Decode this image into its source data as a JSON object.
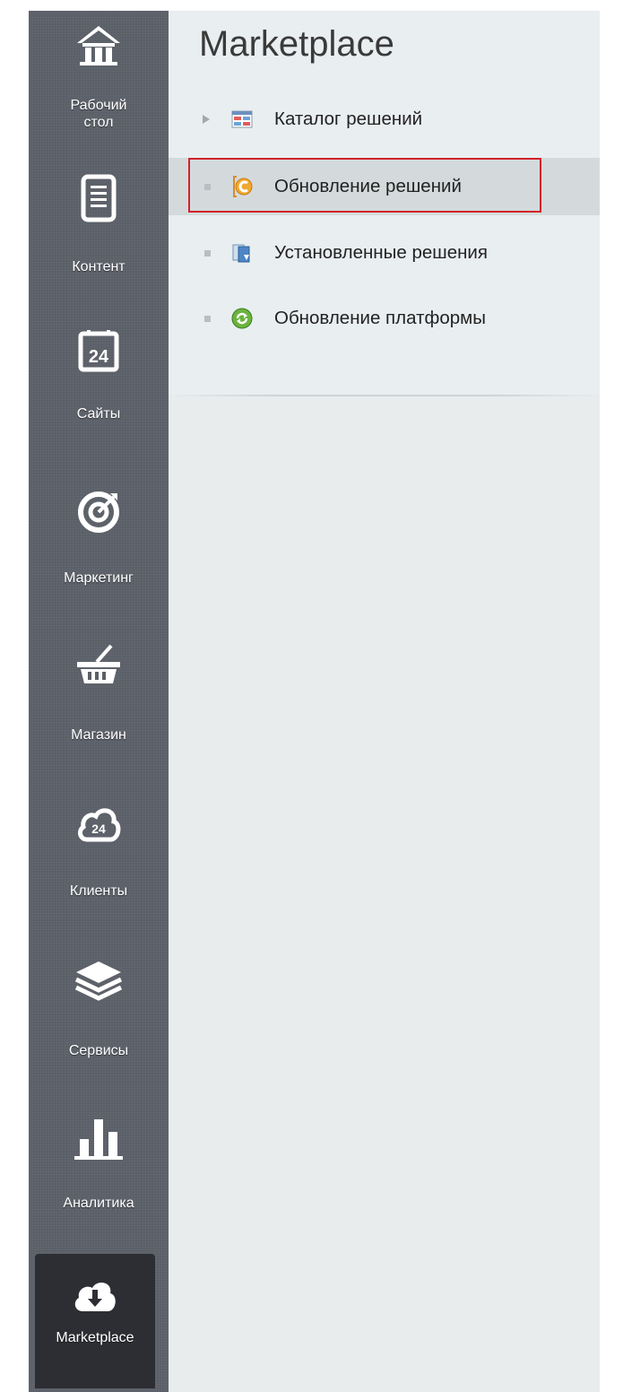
{
  "sidebar": {
    "items": [
      {
        "label": "Рабочий\nстол",
        "icon": "house-icon"
      },
      {
        "label": "Контент",
        "icon": "document-icon"
      },
      {
        "label": "Сайты",
        "icon": "calendar-24-icon",
        "icon_text": "24"
      },
      {
        "label": "Маркетинг",
        "icon": "target-icon"
      },
      {
        "label": "Магазин",
        "icon": "basket-icon"
      },
      {
        "label": "Клиенты",
        "icon": "cloud-24-icon",
        "icon_text": "24"
      },
      {
        "label": "Сервисы",
        "icon": "layers-icon"
      },
      {
        "label": "Аналитика",
        "icon": "bar-chart-icon"
      },
      {
        "label": "Marketplace",
        "icon": "cloud-download-icon",
        "active": true
      }
    ]
  },
  "main": {
    "title": "Marketplace",
    "menu": [
      {
        "label": "Каталог решений",
        "icon": "catalog-icon",
        "expandable": true
      },
      {
        "label": "Обновление решений",
        "icon": "update-solutions-icon",
        "selected": true,
        "highlighted": true
      },
      {
        "label": "Установленные решения",
        "icon": "installed-solutions-icon"
      },
      {
        "label": "Обновление платформы",
        "icon": "platform-update-icon"
      }
    ]
  },
  "colors": {
    "sidebar_bg": "#5b5f67",
    "sidebar_active_bg": "#2c2e33",
    "content_bg": "#e8eced",
    "selected_row_bg": "#d4dadc",
    "highlight_border": "#d2222a"
  }
}
